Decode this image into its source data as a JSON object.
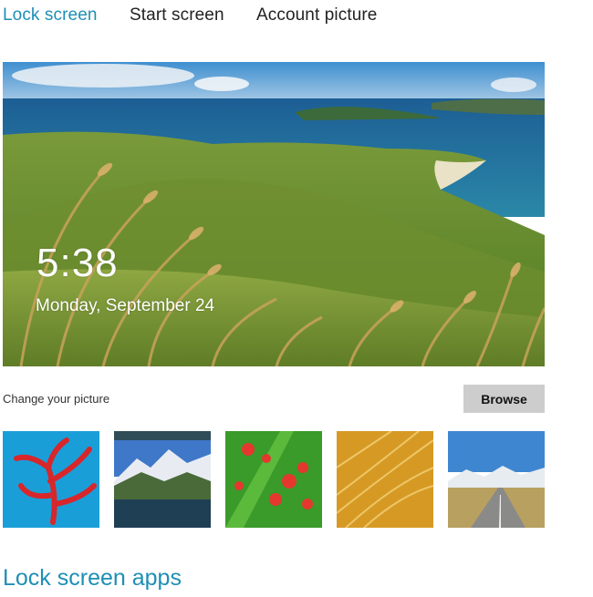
{
  "tabs": [
    {
      "label": "Lock screen",
      "active": true
    },
    {
      "label": "Start screen",
      "active": false
    },
    {
      "label": "Account picture",
      "active": false
    }
  ],
  "preview": {
    "time": "5:38",
    "date": "Monday, September 24",
    "image": "coastal-grass-hills"
  },
  "change_picture": {
    "label": "Change your picture",
    "browse_label": "Browse"
  },
  "thumbnails": [
    {
      "name": "red-coral"
    },
    {
      "name": "mountain-lake"
    },
    {
      "name": "red-flowers"
    },
    {
      "name": "golden-grass"
    },
    {
      "name": "mountain-road"
    }
  ],
  "section": {
    "title": "Lock screen apps"
  },
  "colors": {
    "accent": "#1e8fb5",
    "button_bg": "#cdcdcd"
  }
}
